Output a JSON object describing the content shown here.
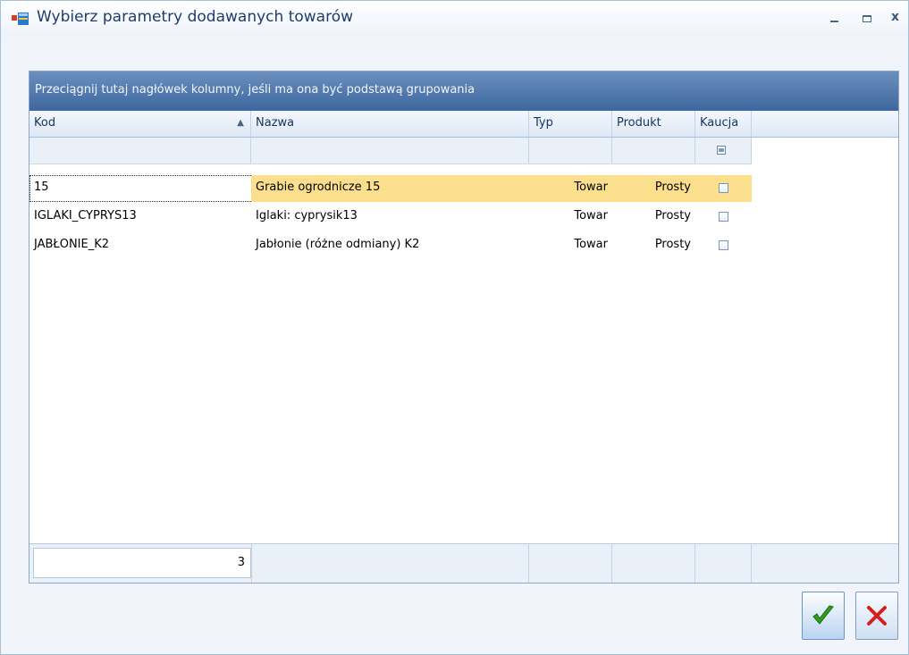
{
  "window": {
    "title": "Wybierz parametry dodawanych towarów",
    "controls": {
      "minimize": "–",
      "maximize": "▭",
      "close": "x"
    }
  },
  "grid": {
    "group_panel_text": "Przeciągnij tutaj nagłówek kolumny, jeśli ma ona być podstawą grupowania",
    "columns": [
      {
        "key": "kod",
        "label": "Kod",
        "sort": "ascending"
      },
      {
        "key": "nazwa",
        "label": "Nazwa"
      },
      {
        "key": "typ",
        "label": "Typ"
      },
      {
        "key": "produkt",
        "label": "Produkt"
      },
      {
        "key": "kaucja",
        "label": "Kaucja"
      }
    ],
    "sort_indicator": "▲",
    "rows": [
      {
        "kod": "15",
        "nazwa": "Grabie ogrodnicze 15",
        "typ": "Towar",
        "produkt": "Prosty",
        "kaucja": false,
        "selected": true
      },
      {
        "kod": "IGLAKI_CYPRYS13",
        "nazwa": "Iglaki: cyprysik13",
        "typ": "Towar",
        "produkt": "Prosty",
        "kaucja": false,
        "selected": false
      },
      {
        "kod": "JABŁONIE_K2",
        "nazwa": "Jabłonie (różne odmiany) K2",
        "typ": "Towar",
        "produkt": "Prosty",
        "kaucja": false,
        "selected": false
      }
    ],
    "footer_count": "3"
  },
  "buttons": {
    "ok_icon": "checkmark-icon",
    "cancel_icon": "x-icon"
  },
  "colors": {
    "group_panel": "#4f75aa",
    "selected_row": "#fcdf8c",
    "ok_green": "#2f9e1f",
    "cancel_red": "#d62020"
  }
}
